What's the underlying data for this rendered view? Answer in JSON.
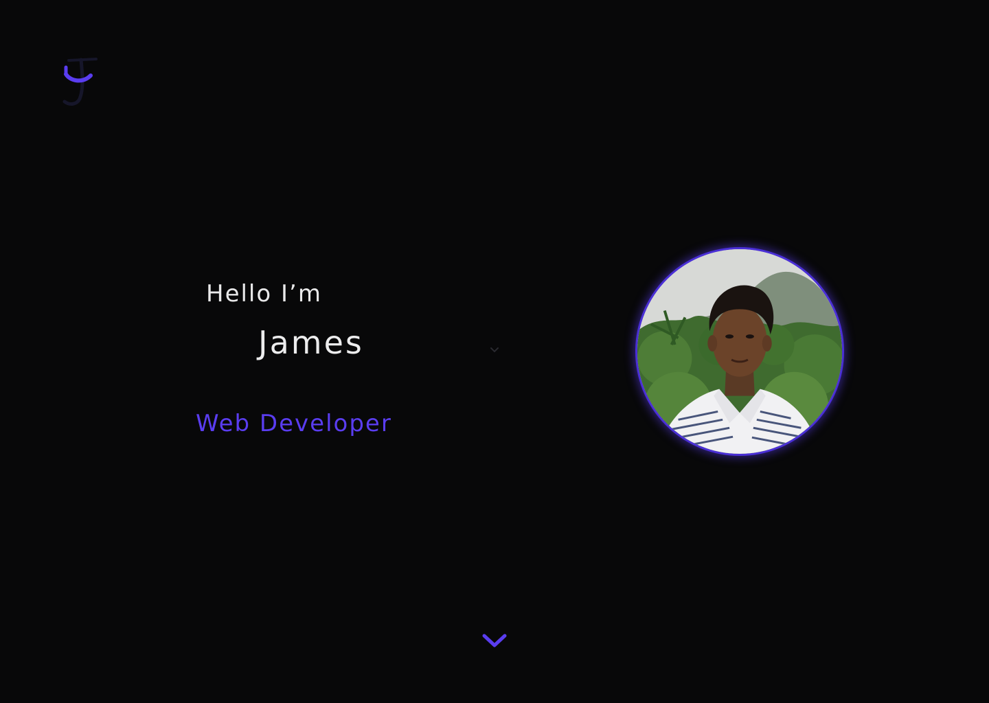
{
  "logo": {
    "icon": "logo-jf-monogram-icon",
    "accent": "#5a3df0"
  },
  "hero": {
    "greeting": "Hello I’m",
    "name": "James",
    "role": "Web Developer",
    "accent_color": "#5a3df0"
  },
  "profile_photo": {
    "icon": "profile-photo"
  },
  "scroll_indicator": {
    "icon": "chevron-down-icon"
  }
}
